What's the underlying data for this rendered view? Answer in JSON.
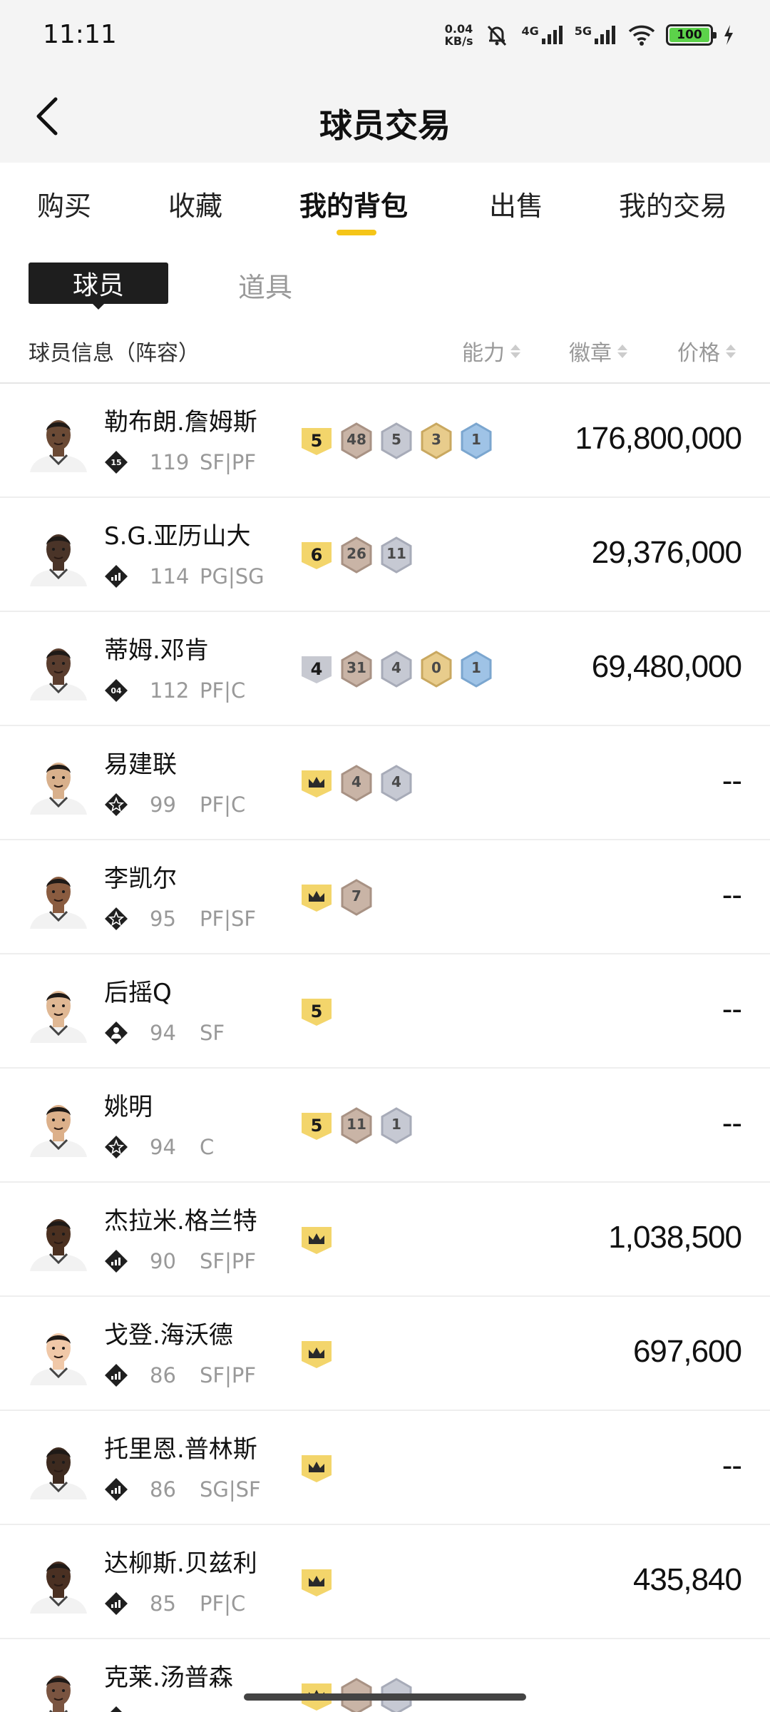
{
  "status_bar": {
    "time": "11:11",
    "net_speed_value": "0.04",
    "net_speed_unit": "KB/s",
    "sig1_label": "4G",
    "sig2_label": "5G",
    "battery": "100",
    "icons": [
      "mute-bell-icon",
      "signal-4g-icon",
      "signal-5g-icon",
      "wifi-icon",
      "battery-icon",
      "charging-icon"
    ]
  },
  "header": {
    "title": "球员交易",
    "back_icon": "chevron-left-icon"
  },
  "tabs": [
    {
      "label": "购买"
    },
    {
      "label": "收藏"
    },
    {
      "label": "我的背包",
      "active": true
    },
    {
      "label": "出售"
    },
    {
      "label": "我的交易"
    }
  ],
  "subtabs": {
    "player": "球员",
    "items": "道具"
  },
  "columns": {
    "info": "球员信息（阵容）",
    "ability": "能力",
    "badge": "徽章",
    "price": "价格"
  },
  "players": [
    {
      "name": "勒布朗.詹姆斯",
      "tier_label": "15",
      "tier_icon": "number-tier-icon",
      "ability": "119",
      "position": "SF|PF",
      "price": "176,800,000",
      "avatar_skin": "#6b4a35",
      "badges": [
        {
          "type": "grade",
          "value": "5"
        },
        {
          "type": "bronze",
          "value": "48"
        },
        {
          "type": "silver",
          "value": "5"
        },
        {
          "type": "gold",
          "value": "3"
        },
        {
          "type": "blue",
          "value": "1"
        }
      ]
    },
    {
      "name": "S.G.亚历山大",
      "tier_label": "",
      "tier_icon": "signal-bars-tier-icon",
      "ability": "114",
      "position": "PG|SG",
      "price": "29,376,000",
      "avatar_skin": "#4a3428",
      "badges": [
        {
          "type": "grade",
          "value": "6"
        },
        {
          "type": "bronze",
          "value": "26"
        },
        {
          "type": "silver",
          "value": "11"
        }
      ]
    },
    {
      "name": "蒂姆.邓肯",
      "tier_label": "04",
      "tier_icon": "number-tier-icon",
      "ability": "112",
      "position": "PF|C",
      "price": "69,480,000",
      "avatar_skin": "#5a3d2e",
      "badges": [
        {
          "type": "grade-silver",
          "value": "4"
        },
        {
          "type": "bronze",
          "value": "31"
        },
        {
          "type": "silver",
          "value": "4"
        },
        {
          "type": "gold",
          "value": "0"
        },
        {
          "type": "blue",
          "value": "1"
        }
      ]
    },
    {
      "name": "易建联",
      "tier_label": "",
      "tier_icon": "star-tier-icon",
      "ability": "99",
      "position": "PF|C",
      "price": "--",
      "avatar_skin": "#d8b08c",
      "badges": [
        {
          "type": "crown",
          "value": ""
        },
        {
          "type": "bronze",
          "value": "4"
        },
        {
          "type": "silver",
          "value": "4"
        }
      ]
    },
    {
      "name": "李凯尔",
      "tier_label": "",
      "tier_icon": "star-tier-icon",
      "ability": "95",
      "position": "PF|SF",
      "price": "--",
      "avatar_skin": "#8a5c40",
      "badges": [
        {
          "type": "crown",
          "value": ""
        },
        {
          "type": "bronze",
          "value": "7"
        }
      ]
    },
    {
      "name": "后摇Q",
      "tier_label": "",
      "tier_icon": "person-tier-icon",
      "ability": "94",
      "position": "SF",
      "price": "--",
      "avatar_skin": "#e0b894",
      "badges": [
        {
          "type": "grade",
          "value": "5"
        }
      ]
    },
    {
      "name": "姚明",
      "tier_label": "",
      "tier_icon": "star-tier-icon",
      "ability": "94",
      "position": "C",
      "price": "--",
      "avatar_skin": "#dcb08a",
      "badges": [
        {
          "type": "grade",
          "value": "5"
        },
        {
          "type": "bronze",
          "value": "11"
        },
        {
          "type": "silver",
          "value": "1"
        }
      ]
    },
    {
      "name": "杰拉米.格兰特",
      "tier_label": "",
      "tier_icon": "signal-bars-tier-icon",
      "ability": "90",
      "position": "SF|PF",
      "price": "1,038,500",
      "avatar_skin": "#4b3020",
      "badges": [
        {
          "type": "crown",
          "value": ""
        }
      ]
    },
    {
      "name": "戈登.海沃德",
      "tier_label": "",
      "tier_icon": "signal-bars-tier-icon",
      "ability": "86",
      "position": "SF|PF",
      "price": "697,600",
      "avatar_skin": "#f0c8a8",
      "badges": [
        {
          "type": "crown",
          "value": ""
        }
      ]
    },
    {
      "name": "托里恩.普林斯",
      "tier_label": "",
      "tier_icon": "signal-bars-tier-icon",
      "ability": "86",
      "position": "SG|SF",
      "price": "--",
      "avatar_skin": "#3d2a1f",
      "badges": [
        {
          "type": "crown",
          "value": ""
        }
      ]
    },
    {
      "name": "达柳斯.贝兹利",
      "tier_label": "",
      "tier_icon": "signal-bars-tier-icon",
      "ability": "85",
      "position": "PF|C",
      "price": "435,840",
      "avatar_skin": "#4a3022",
      "badges": [
        {
          "type": "crown",
          "value": ""
        }
      ]
    },
    {
      "name": "克莱.汤普森",
      "tier_label": "",
      "tier_icon": "signal-bars-tier-icon",
      "ability": "",
      "position": "",
      "price": "",
      "avatar_skin": "#7a5440",
      "badges": [
        {
          "type": "crown",
          "value": ""
        },
        {
          "type": "bronze",
          "value": ""
        },
        {
          "type": "silver",
          "value": ""
        }
      ]
    }
  ],
  "colors": {
    "accent": "#f5c518",
    "grade_yellow": "#f3d56b",
    "grade_silver": "#c7c9d1",
    "bronze": "#c9b4a6",
    "silver": "#c6c9d3",
    "gold": "#e8cc8c",
    "blue": "#9fc3e6"
  }
}
